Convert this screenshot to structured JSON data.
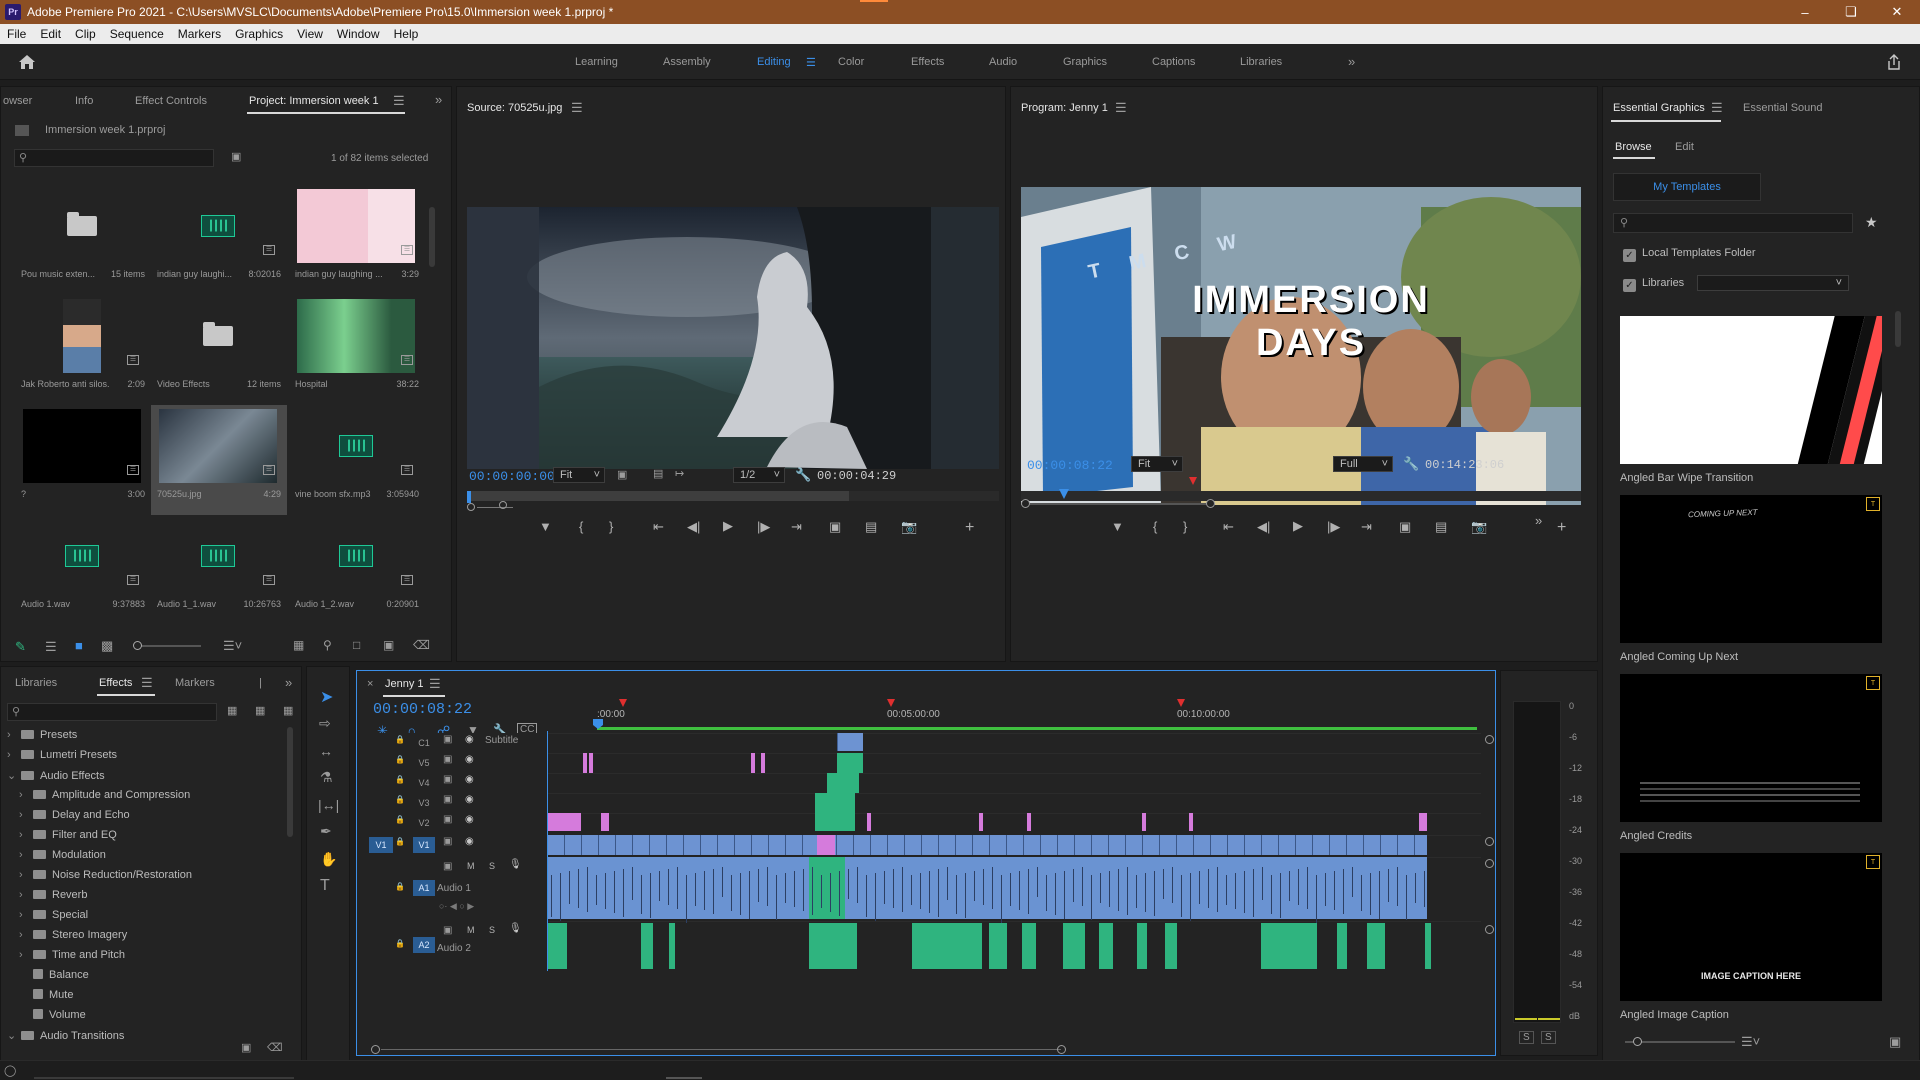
{
  "window": {
    "title": "Adobe Premiere Pro 2021 - C:\\Users\\MVSLC\\Documents\\Adobe\\Premiere Pro\\15.0\\Immersion week 1.prproj *",
    "logo": "Pr"
  },
  "menu": [
    "File",
    "Edit",
    "Clip",
    "Sequence",
    "Markers",
    "Graphics",
    "View",
    "Window",
    "Help"
  ],
  "workspaces": [
    "Learning",
    "Assembly",
    "Editing",
    "Color",
    "Effects",
    "Audio",
    "Graphics",
    "Captions",
    "Libraries"
  ],
  "active_workspace": "Editing",
  "project_panel": {
    "tabs": [
      "owser",
      "Info",
      "Effect Controls",
      "Project: Immersion week 1"
    ],
    "file": "Immersion week 1.prproj",
    "selected_count": "1 of 82 items selected",
    "items": [
      {
        "name": "Pou music exten...",
        "meta": "15 items",
        "kind": "folder"
      },
      {
        "name": "indian guy laughi...",
        "meta": "8:02016",
        "kind": "audio"
      },
      {
        "name": "indian guy laughing ...",
        "meta": "3:29",
        "kind": "image-pink"
      },
      {
        "name": "Jak Roberto anti silos...",
        "meta": "2:09",
        "kind": "image-person"
      },
      {
        "name": "Video Effects",
        "meta": "12 items",
        "kind": "folder"
      },
      {
        "name": "Hospital",
        "meta": "38:22",
        "kind": "image-green"
      },
      {
        "name": "?",
        "meta": "3:00",
        "kind": "black"
      },
      {
        "name": "70525u.jpg",
        "meta": "4:29",
        "kind": "image-wolf"
      },
      {
        "name": "vine boom sfx.mp3",
        "meta": "3:05940",
        "kind": "audio"
      },
      {
        "name": "Audio 1.wav",
        "meta": "9:37883",
        "kind": "audio"
      },
      {
        "name": "Audio 1_1.wav",
        "meta": "10:26763",
        "kind": "audio"
      },
      {
        "name": "Audio 1_2.wav",
        "meta": "0:20901",
        "kind": "audio"
      }
    ]
  },
  "source": {
    "title": "Source: 70525u.jpg",
    "timecode": "00:00:00:00",
    "fit": "Fit",
    "resolution": "1/2",
    "duration": "00:00:04:29"
  },
  "program": {
    "title": "Program: Jenny 1",
    "timecode": "00:00:08:22",
    "fit": "Fit",
    "quality": "Full",
    "duration": "00:14:23:06",
    "overlay_line1": "IMMERSION",
    "overlay_line2": "DAYS",
    "sign": "T M C W"
  },
  "effects_panel": {
    "tabs": [
      "Libraries",
      "Effects",
      "Markers"
    ],
    "items": [
      {
        "label": "Presets",
        "level": 0,
        "open": false
      },
      {
        "label": "Lumetri Presets",
        "level": 0,
        "open": false
      },
      {
        "label": "Audio Effects",
        "level": 0,
        "open": true
      },
      {
        "label": "Amplitude and Compression",
        "level": 1,
        "open": false
      },
      {
        "label": "Delay and Echo",
        "level": 1,
        "open": false
      },
      {
        "label": "Filter and EQ",
        "level": 1,
        "open": false
      },
      {
        "label": "Modulation",
        "level": 1,
        "open": false
      },
      {
        "label": "Noise Reduction/Restoration",
        "level": 1,
        "open": false
      },
      {
        "label": "Reverb",
        "level": 1,
        "open": false
      },
      {
        "label": "Special",
        "level": 1,
        "open": false
      },
      {
        "label": "Stereo Imagery",
        "level": 1,
        "open": false
      },
      {
        "label": "Time and Pitch",
        "level": 1,
        "open": false
      },
      {
        "label": "Balance",
        "level": 1,
        "leaf": true
      },
      {
        "label": "Mute",
        "level": 1,
        "leaf": true
      },
      {
        "label": "Volume",
        "level": 1,
        "leaf": true
      },
      {
        "label": "Audio Transitions",
        "level": 0,
        "open": true
      }
    ]
  },
  "timeline": {
    "sequence": "Jenny 1",
    "timecode": "00:00:08:22",
    "ruler": [
      ":00:00",
      "00:05:00:00",
      "00:10:00:00"
    ],
    "tracks": [
      {
        "id": "C1",
        "name": "Subtitle"
      },
      {
        "id": "V5"
      },
      {
        "id": "V4"
      },
      {
        "id": "V3"
      },
      {
        "id": "V2"
      },
      {
        "id": "V1",
        "source": "V1"
      },
      {
        "id": "A1",
        "name": "Audio 1"
      },
      {
        "id": "A2",
        "name": "Audio 2"
      }
    ],
    "track_buttons": {
      "mute": "M",
      "solo": "S"
    }
  },
  "meter": {
    "scale": [
      "0",
      "-6",
      "-12",
      "-18",
      "-24",
      "-30",
      "-36",
      "-42",
      "-48",
      "-54",
      "dB"
    ],
    "solo": [
      "S",
      "S"
    ]
  },
  "essential_graphics": {
    "tabs": [
      "Essential Graphics",
      "Essential Sound"
    ],
    "subtabs": [
      "Browse",
      "Edit"
    ],
    "my_templates": "My Templates",
    "local_templates": "Local Templates Folder",
    "libraries": "Libraries",
    "templates": [
      {
        "name": "Angled Bar Wipe Transition",
        "badge": ""
      },
      {
        "name": "Angled Coming Up Next",
        "badge": "T",
        "text": "COMING UP NEXT"
      },
      {
        "name": "Angled Credits",
        "badge": "T"
      },
      {
        "name": "Angled Image Caption",
        "badge": "T",
        "text": "IMAGE CAPTION HERE"
      }
    ]
  },
  "colors": {
    "accent": "#3b8fe8",
    "titlebar": "#8c4f24",
    "audio_green": "#2fb47f",
    "video_blue": "#6d93d2",
    "playhead_red": "#e02f2f"
  }
}
